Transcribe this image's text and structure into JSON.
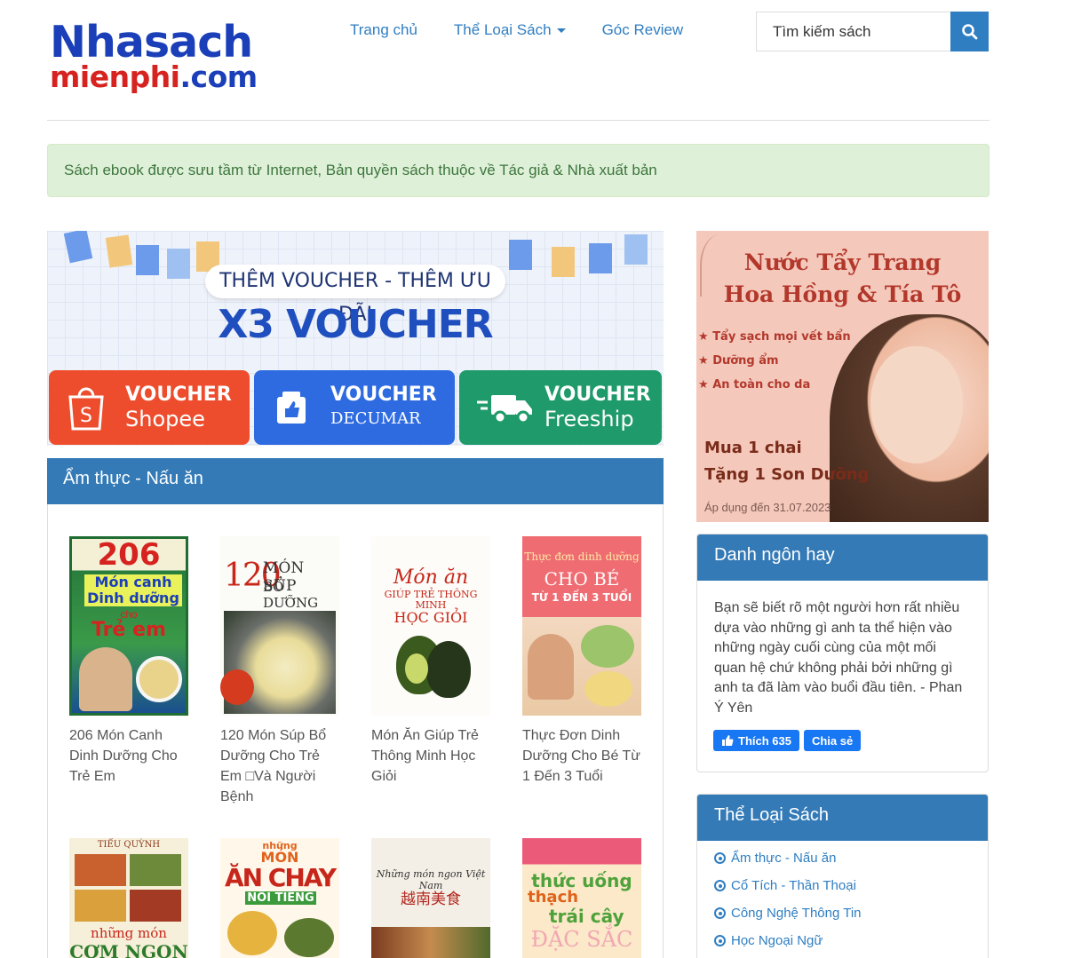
{
  "logo": {
    "line1": "Nhasach",
    "line2a": "mienphi",
    "line2b": ".com"
  },
  "nav": {
    "home": "Trang chủ",
    "categories": "Thể Loại Sách",
    "review": "Góc Review"
  },
  "search": {
    "placeholder": "Tìm kiếm sách"
  },
  "notice": "Sách ebook được sưu tầm từ Internet, Bản quyền sách thuộc về Tác giả & Nhà xuất bản",
  "banner": {
    "pill": "THÊM VOUCHER - THÊM ƯU ĐÃI",
    "big": "X3 VOUCHER",
    "cards": [
      {
        "t1": "VOUCHER",
        "t2": "Shopee",
        "color": "#ee4d2d"
      },
      {
        "t1": "VOUCHER",
        "t2": "DECUMAR",
        "color": "#2f6be0"
      },
      {
        "t1": "VOUCHER",
        "t2": "Freeship",
        "color": "#1f9a6a"
      }
    ]
  },
  "section": {
    "title": "Ẩm thực - Nấu ăn",
    "books": [
      {
        "title": "206 Món Canh Dinh Dưỡng Cho Trẻ Em",
        "cover_top": "206",
        "cover_mid": "Món canh Dinh dưỡng",
        "cover_low": "cho",
        "cover_end": "Trẻ em"
      },
      {
        "title": "120 Món Súp Bổ Dưỡng Cho Trẻ Em □Và Người Bệnh",
        "cover_top": "120",
        "cover_mid": "MÓN SÚP",
        "cover_low": "BỔ DƯỠNG"
      },
      {
        "title": "Món Ăn Giúp Trẻ Thông Minh Học Giỏi",
        "cover_top": "Món ăn",
        "cover_mid": "GIÚP TRẺ THÔNG MINH",
        "cover_low": "HỌC GIỎI"
      },
      {
        "title": "Thực Đơn Dinh Dưỡng Cho Bé Từ 1 Đến 3 Tuổi",
        "cover_top": "Thực đơn dinh dưỡng",
        "cover_mid": "CHO BÉ",
        "cover_low": "TỪ 1 ĐẾN 3 TUỔI"
      },
      {
        "cover_top": "TIỂU QUỲNH",
        "cover_low": "những món",
        "cover_end": "CƠM NGON"
      },
      {
        "cover_top": "những",
        "cover_mid": "MÓN",
        "cover_low": "ĂN CHAY",
        "cover_end": "NỔI TIẾNG"
      },
      {
        "cover_top": "Những món ngon Việt Nam",
        "cover_mid": "越南美食"
      },
      {
        "cover_top": "thức uống",
        "cover_mid": "thạch",
        "cover_low": "trái cây",
        "cover_end": "ĐẶC SẮC"
      }
    ]
  },
  "ad": {
    "h1": "Nước Tẩy Trang",
    "h2": "Hoa Hồng & Tía Tô",
    "bullets": [
      "Tẩy sạch mọi vết bẩn",
      "Dưỡng ẩm",
      "An toàn cho da"
    ],
    "promo1": "Mua 1 chai",
    "promo2": "Tặng 1 Son Dưỡng",
    "date": "Áp dụng đến 31.07.2023"
  },
  "quote_box": {
    "title": "Danh ngôn hay",
    "text": "Bạn sẽ biết rõ một người hơn rất nhiều dựa vào những gì anh ta thể hiện vào những ngày cuối cùng của một mối quan hệ chứ không phải bởi những gì anh ta đã làm vào buổi đầu tiên. - Phan Ý Yên",
    "like": "Thích 635",
    "share": "Chia sẻ"
  },
  "cat_box": {
    "title": "Thể Loại Sách",
    "items": [
      "Ẩm thực - Nấu ăn",
      "Cổ Tích - Thần Thoại",
      "Công Nghệ Thông Tin",
      "Học Ngoại Ngữ"
    ]
  },
  "colors": {
    "primary": "#337ab7",
    "link": "#2f7ec2",
    "notice_bg": "#dff0d8",
    "notice_text": "#3c763d"
  }
}
